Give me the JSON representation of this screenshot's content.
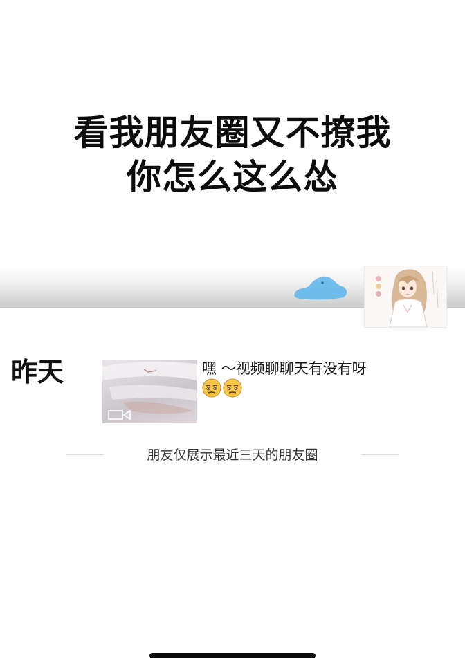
{
  "headline": {
    "line1": "看我朋友圈又不撩我",
    "line2": "你怎么这么怂"
  },
  "profile": {
    "avatar_icon": "anime-girl-avatar-icon",
    "cover_icon": "blue-cloud-icon"
  },
  "feed": {
    "day_label": "昨天",
    "post": {
      "media_type": "video",
      "media_icon": "video-camera-icon",
      "text": "嘿 ～视频聊聊天有没有呀",
      "emoji_icon": "smirk-face-emoji-icon",
      "emoji_count": 2
    }
  },
  "footer": {
    "notice": "朋友仅展示最近三天的朋友圈"
  }
}
